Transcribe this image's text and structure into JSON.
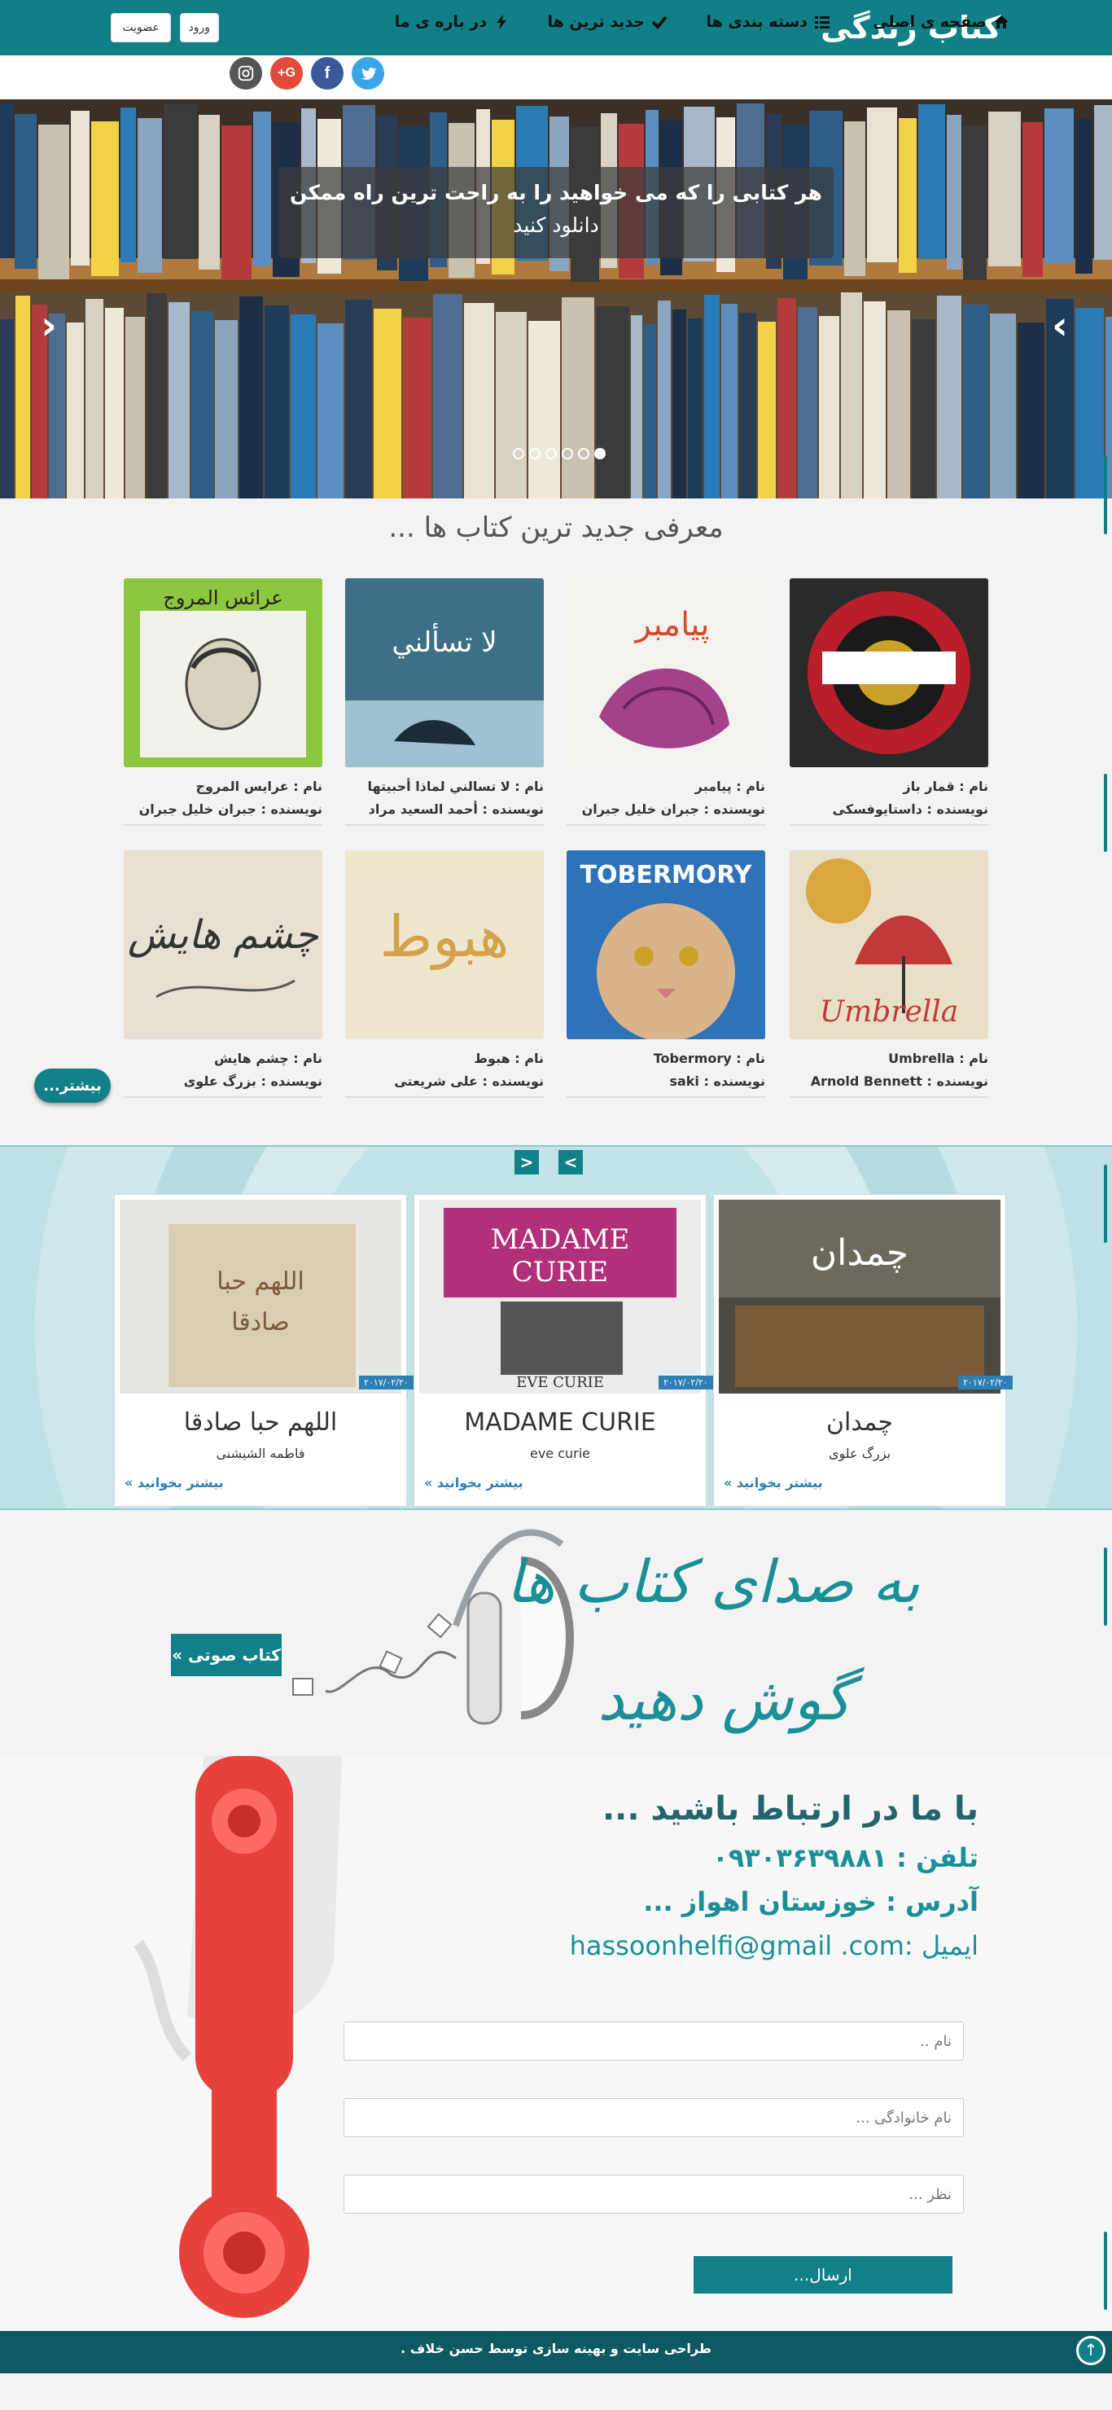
{
  "header": {
    "site_title": "کتاب زندگی",
    "login_label": "ورود",
    "register_label": "عضویت"
  },
  "nav": {
    "items": [
      {
        "label": "صفحه ی اصلی",
        "icon": "home-icon"
      },
      {
        "label": "دسته بندی ها",
        "icon": "list-icon"
      },
      {
        "label": "جدید ترین ها",
        "icon": "check-icon"
      },
      {
        "label": "در باره ی ما",
        "icon": "bolt-icon"
      }
    ],
    "social": [
      {
        "name": "twitter-icon",
        "color": "#3aa6e8"
      },
      {
        "name": "facebook-icon",
        "color": "#3b5998"
      },
      {
        "name": "google-plus-icon",
        "color": "#e14b3b"
      },
      {
        "name": "instagram-icon",
        "color": "#555555"
      }
    ]
  },
  "hero": {
    "caption_line1": "هر کتابی را که می خواهید را به راحت ترین راه ممکن",
    "caption_line2": "دانلود کنید",
    "slide_count": 6,
    "active_slide": 1
  },
  "new_books": {
    "title": "معرفی جدید ترین کتاب ها ...",
    "name_prefix": "نام :",
    "author_prefix": "نویسنده :",
    "items": [
      {
        "name": "قمار باز",
        "author": "داستایوفسکی"
      },
      {
        "name": "پیامبر",
        "author": "جبران خلیل جبران"
      },
      {
        "name": "لا تسالني لماذا أحبيتها",
        "author": "أحمد السعید مراد"
      },
      {
        "name": "عرایس المروج",
        "author": "جبران خلیل جبران"
      },
      {
        "name": "Umbrella",
        "author": "Arnold Bennett"
      },
      {
        "name": "Tobermory",
        "author": "saki"
      },
      {
        "name": "هبوط",
        "author": "علی شریعتی"
      },
      {
        "name": "چشم هایش",
        "author": "بزرگ علوی"
      }
    ],
    "more_label": "بیشتر..."
  },
  "carousel": {
    "prev_label": "<",
    "next_label": ">",
    "read_more_label": "بیشتر بخوانید »",
    "items": [
      {
        "title": "چمدان",
        "author": "بزرگ علوی",
        "date": "۲۰۱۷/۰۲/۲۰"
      },
      {
        "title": "MADAME CURIE",
        "author": "eve curie",
        "date": "۲۰۱۷/۰۲/۲۰"
      },
      {
        "title": "اللهم حبا صادقا",
        "author": "فاطمه الشیشنی",
        "date": "۲۰۱۷/۰۲/۲۰"
      }
    ]
  },
  "audio": {
    "slogan_line1": "به صدای کتاب ها",
    "slogan_line2": "گوش دهید",
    "button_label": "کتاب صوتی »"
  },
  "contact": {
    "title": "با ما در ارتباط باشید ...",
    "phone": "تلفن : ۰۹۳۰۳۶۳۹۸۸۱",
    "address": "آدرس : خوزستان اهواز ...",
    "email": "ایمیل :hassoonhelfi@gmail .com",
    "form": {
      "name_placeholder": "نام ..",
      "family_placeholder": "نام خانوادگی ...",
      "comment_placeholder": "نظر ...",
      "send_label": "ارسال..."
    }
  },
  "footer": {
    "text": "طراحی سایت و بهینه سازی توسط حسن خلاف ."
  }
}
